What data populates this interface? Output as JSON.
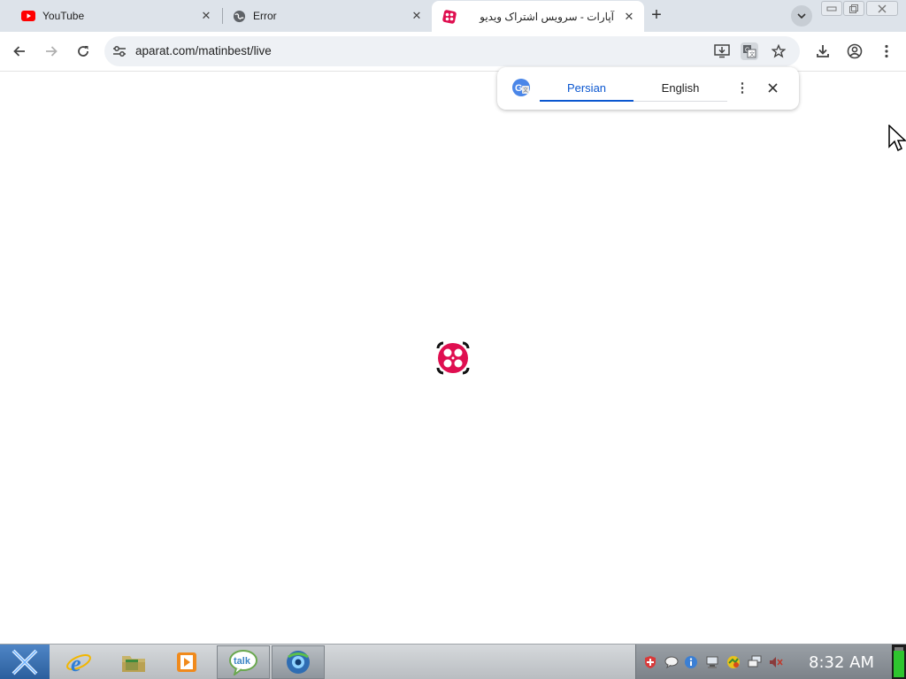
{
  "tabs": [
    {
      "title": "YouTube",
      "favicon": "youtube-icon"
    },
    {
      "title": "Error",
      "favicon": "globe-icon"
    },
    {
      "title": "آپارات - سرویس اشتراک ویدیو",
      "favicon": "aparat-icon",
      "active": true
    }
  ],
  "toolbar": {
    "url": "aparat.com/matinbest/live"
  },
  "translate_bubble": {
    "source_lang": "Persian",
    "target_lang": "English"
  },
  "taskbar": {
    "clock": "8:32 AM"
  },
  "colors": {
    "accent": "#0b57d0",
    "aparat": "#df0f50",
    "tabstrip": "#dde3ea"
  }
}
